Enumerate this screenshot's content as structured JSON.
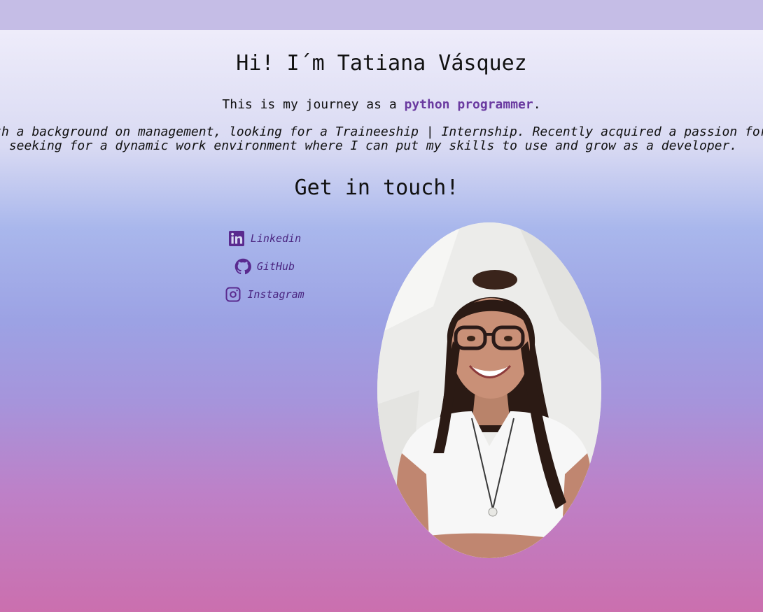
{
  "header": {
    "title": "Hi! I´m Tatiana Vásquez"
  },
  "intro": {
    "tagline_prefix": "This is my journey as a ",
    "tagline_accent": "python programmer",
    "tagline_suffix": ".",
    "bio_line1": "Professional with a background on management, looking for a Traineeship | Internship. Recently acquired a passion for programming,",
    "bio_line2": "seeking for a dynamic work environment where I can put my skills to use and grow as a developer."
  },
  "contact": {
    "heading": "Get in touch!",
    "links": [
      {
        "label": "Linkedin",
        "icon": "linkedin-icon"
      },
      {
        "label": "GitHub",
        "icon": "github-icon"
      },
      {
        "label": "Instagram",
        "icon": "instagram-icon"
      }
    ]
  },
  "colors": {
    "accent": "#6a3aa0",
    "link": "#4a2580",
    "top_band": "#c5bde6"
  }
}
